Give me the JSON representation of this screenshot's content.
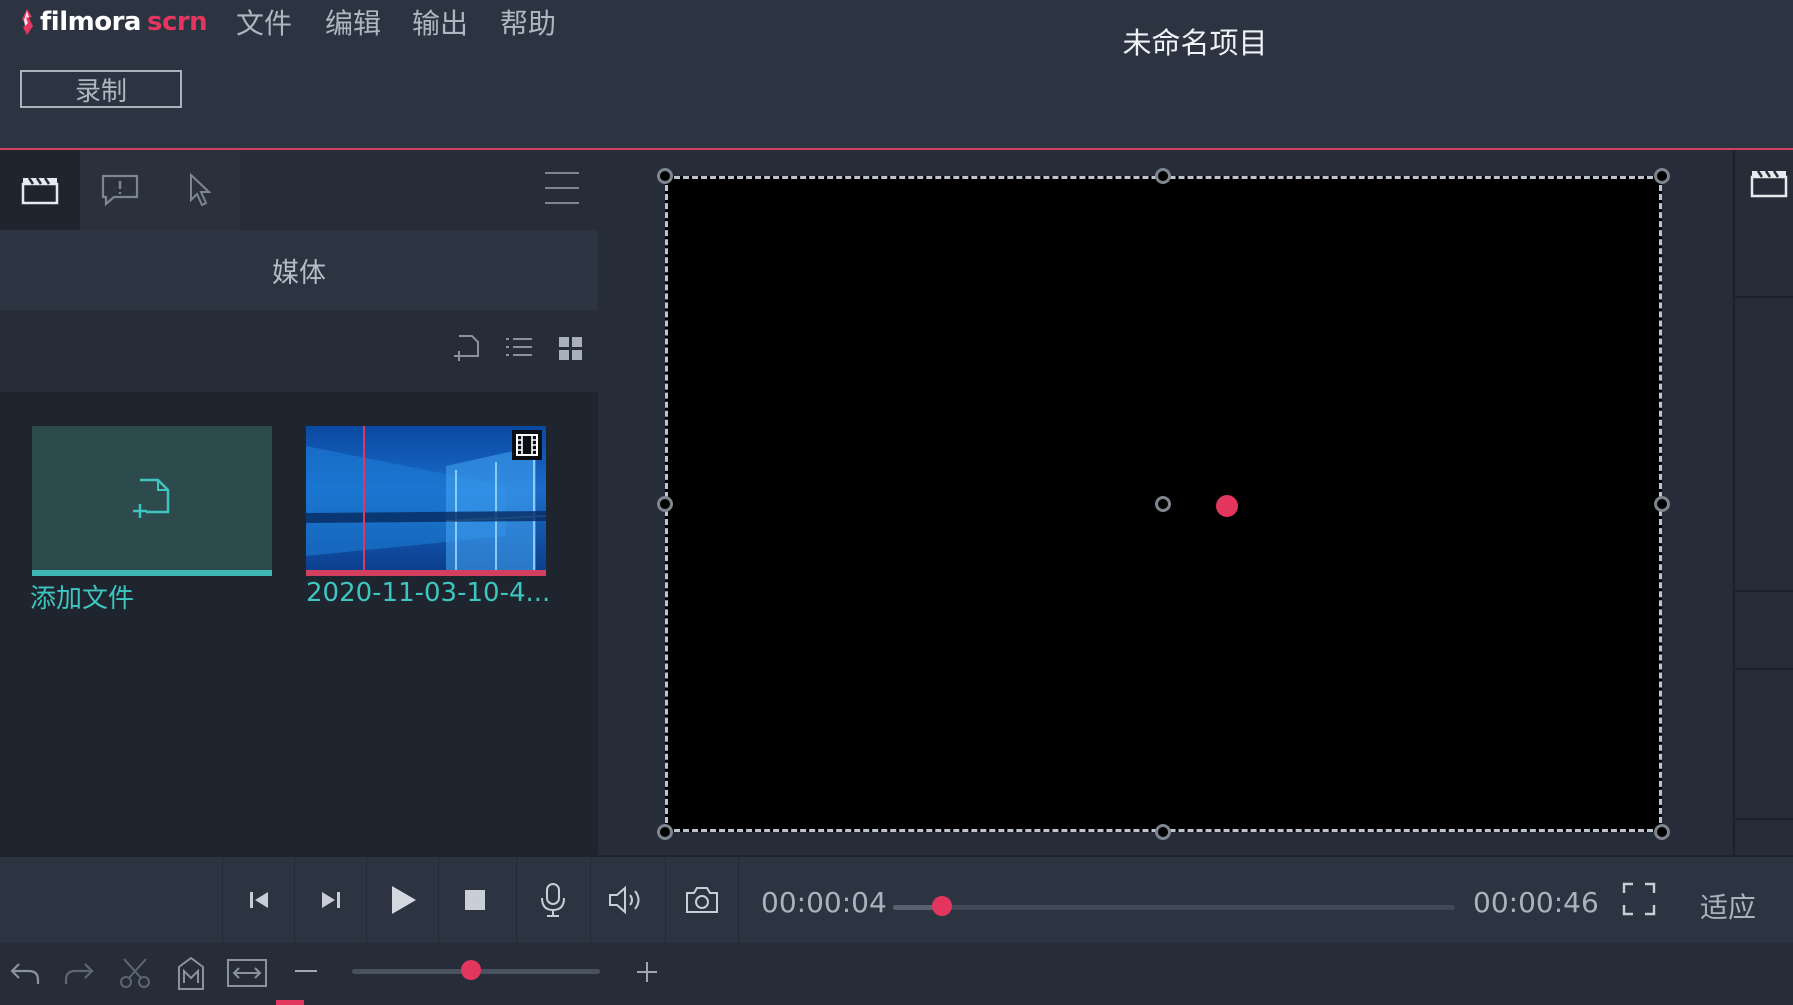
{
  "app": {
    "brand_main": "filmora",
    "brand_accent": "scrn",
    "brand_color": "#e2365e"
  },
  "menu": {
    "items": [
      "文件",
      "编辑",
      "输出",
      "帮助"
    ]
  },
  "project": {
    "title": "未命名项目"
  },
  "toolbar": {
    "record_label": "录制"
  },
  "left_panel": {
    "tabs": [
      {
        "icon": "clapperboard-icon",
        "active": true
      },
      {
        "icon": "annotation-icon",
        "active": false
      },
      {
        "icon": "cursor-icon",
        "active": false
      }
    ],
    "section_title": "媒体",
    "view_icons": [
      "import-icon",
      "list-view-icon",
      "grid-view-icon"
    ],
    "tiles": [
      {
        "label": "添加文件",
        "icon": "add-file-icon"
      },
      {
        "label": "2020-11-03-10-4...",
        "icon": "film-icon"
      }
    ]
  },
  "playback": {
    "current_time": "00:00:04",
    "total_time": "00:00:46",
    "progress": 0.087,
    "fit_label": "适应",
    "buttons": [
      "step-back-icon",
      "step-forward-icon",
      "play-icon",
      "stop-icon",
      "microphone-icon",
      "volume-icon",
      "camera-icon"
    ]
  },
  "timeline": {
    "tools": [
      "undo-icon",
      "redo-icon",
      "cut-icon",
      "marker-icon",
      "fit-width-icon"
    ],
    "zoom_level": 0.48
  },
  "colors": {
    "accent": "#e2365e",
    "teal": "#3fb8b3",
    "bg": "#1f252f",
    "panel": "#2c3442"
  }
}
